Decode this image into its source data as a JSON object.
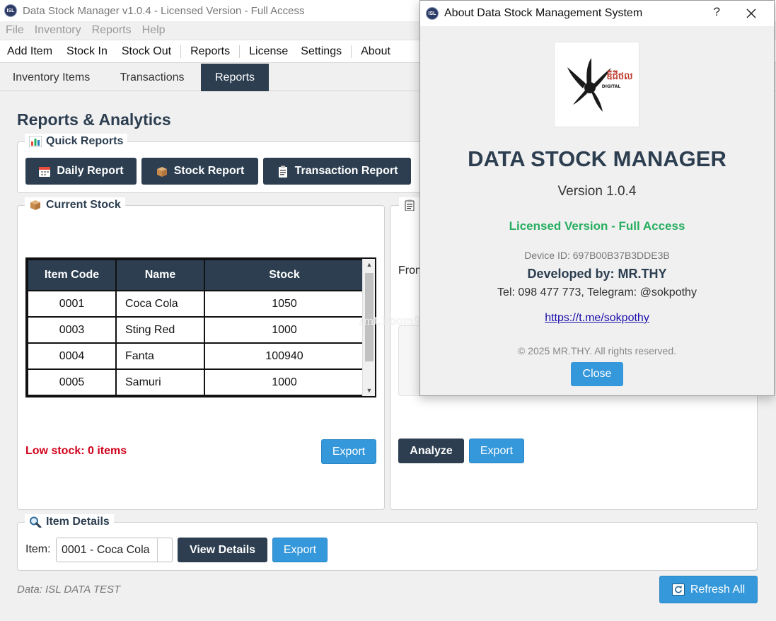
{
  "window": {
    "title": "Data Stock Manager v1.0.4 - Licensed Version - Full Access",
    "icon_text": "ISL"
  },
  "menu": [
    "File",
    "Inventory",
    "Reports",
    "Help"
  ],
  "toolbar": [
    "Add Item",
    "Stock In",
    "Stock Out",
    "Reports",
    "License",
    "Settings",
    "About"
  ],
  "tabs": [
    "Inventory Items",
    "Transactions",
    "Reports"
  ],
  "page_title": "Reports & Analytics",
  "quick_reports": {
    "title": "Quick Reports",
    "icon": "bar-chart-icon",
    "buttons": [
      {
        "label": "Daily Report",
        "icon": "calendar-icon"
      },
      {
        "label": "Stock Report",
        "icon": "box-icon"
      },
      {
        "label": "Transaction Report",
        "icon": "clipboard-icon"
      }
    ]
  },
  "current_stock": {
    "title": "Current Stock",
    "icon": "box-icon",
    "columns": [
      "Item Code",
      "Name",
      "Stock"
    ],
    "rows": [
      [
        "0001",
        "Coca Cola",
        "1050"
      ],
      [
        "0003",
        "Sting Red",
        "1000"
      ],
      [
        "0004",
        "Fanta",
        "100940"
      ],
      [
        "0005",
        "Samuri",
        "1000"
      ]
    ],
    "low_stock": "Low stock: 0 items",
    "export_label": "Export"
  },
  "analysis": {
    "icon": "clipboard-icon",
    "from_label": "From",
    "analyze_label": "Analyze",
    "export_label": "Export"
  },
  "item_details": {
    "title": "Item Details",
    "icon": "search-icon",
    "item_label": "Item:",
    "selected": "0001 - Coca Cola",
    "view_label": "View Details",
    "export_label": "Export"
  },
  "footer": {
    "data_label": "Data: ISL DATA TEST",
    "refresh_label": "Refresh All"
  },
  "about": {
    "title": "About Data Stock Management System",
    "help": "?",
    "app_name": "DATA STOCK MANAGER",
    "version": "Version 1.0.4",
    "license": "Licensed Version - Full Access",
    "device": "Device ID: 697B00B37B3DDE3B",
    "developer": "Developed by: MR.THY",
    "contact": "Tel: 098 477 773, Telegram: @sokpothy",
    "link": "https://t.me/sokpothy",
    "copyright": "© 2025 MR.THY. All rights reserved.",
    "close_label": "Close",
    "logo_text": "DIGITAL"
  },
  "watermark": "/mt.boom93",
  "colors": {
    "dark": "#2c3e50",
    "blue": "#3498db",
    "green": "#27ae60",
    "red": "#d0021b"
  }
}
